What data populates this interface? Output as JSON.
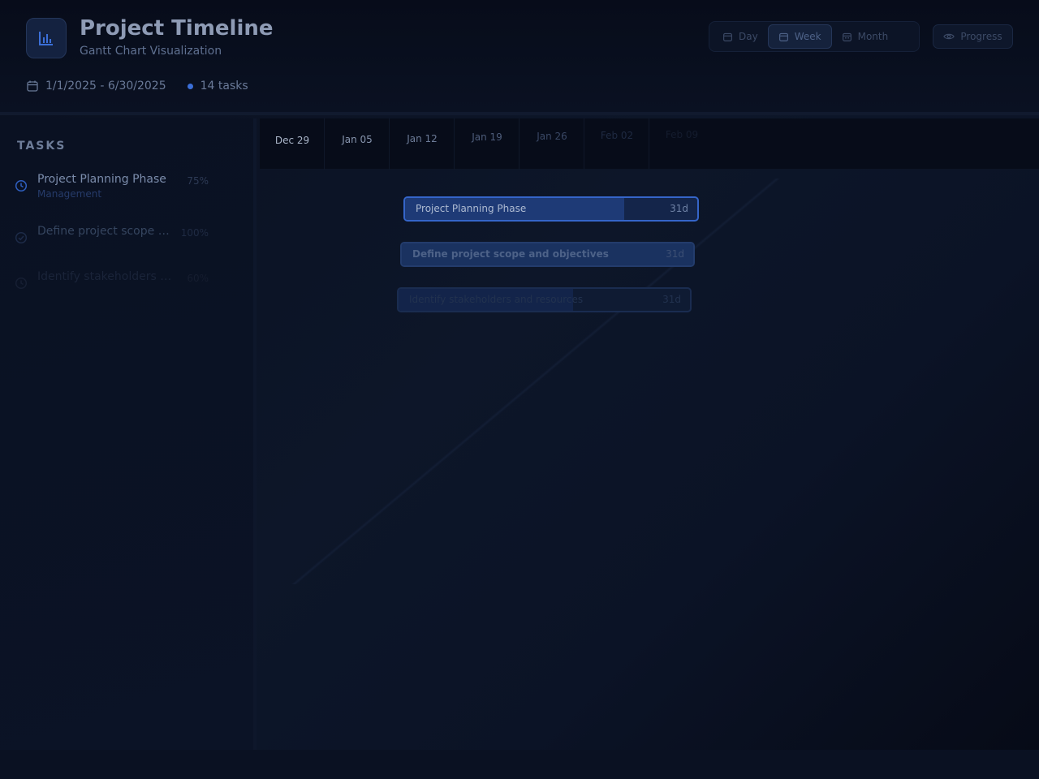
{
  "header": {
    "title": "Project Timeline",
    "subtitle": "Gantt Chart Visualization",
    "date_range": "1/1/2025 - 6/30/2025",
    "task_count": "14 tasks",
    "views": [
      {
        "label": "Day",
        "icon": "calendar-icon",
        "active": false
      },
      {
        "label": "Week",
        "icon": "calendar-icon",
        "active": true
      },
      {
        "label": "Month",
        "icon": "calendar-icon",
        "active": false
      }
    ],
    "progress_label": "Progress",
    "accent": "#3b6fd8"
  },
  "sidebar": {
    "heading": "TASKS",
    "tasks": [
      {
        "name": "Project Planning Phase",
        "category": "Management",
        "percent": "75%",
        "icon": "clock-icon"
      },
      {
        "name": "Define project scope and objectives",
        "category": "",
        "percent": "100%",
        "icon": "check-circle-icon"
      },
      {
        "name": "Identify stakeholders and resources",
        "category": "",
        "percent": "60%",
        "icon": "clock-icon"
      }
    ]
  },
  "timeline": {
    "weeks": [
      "Dec 29",
      "Jan 05",
      "Jan 12",
      "Jan 19",
      "Jan 26",
      "Feb 02",
      "Feb 09"
    ],
    "bars": [
      {
        "label": "Project Planning Phase",
        "duration": "31d",
        "progress": 0.75
      },
      {
        "label": "Define project scope and objectives",
        "duration": "31d",
        "progress": 1.0
      },
      {
        "label": "Identify stakeholders and resources",
        "duration": "31d",
        "progress": 0.6
      }
    ]
  }
}
